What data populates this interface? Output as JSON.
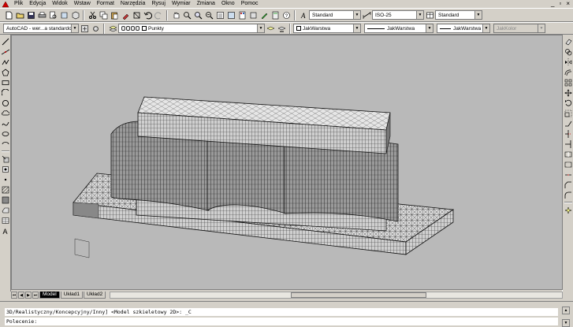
{
  "menu": {
    "items": [
      "Plik",
      "Edycja",
      "Widok",
      "Wstaw",
      "Format",
      "Narzędzia",
      "Rysuj",
      "Wymiar",
      "Zmiana",
      "Okno",
      "Pomoc"
    ],
    "window_controls": [
      "_",
      "▫",
      "×"
    ]
  },
  "toolbar1": {
    "text_style": "Standard",
    "dim_style": "ISO-25",
    "table_style": "Standard"
  },
  "toolbar2": {
    "workspace": "AutoCAD - wer...a standardowy",
    "layer": "Punkty",
    "color": "JakWarstwa",
    "linetype": "JakWarstwa",
    "lineweight": "JakWarstwa",
    "plotstyle": "JakKolor"
  },
  "tabs": {
    "items": [
      "Model",
      "Układ1",
      "Układ2"
    ],
    "active": "Model"
  },
  "command": {
    "history": "3D/Realistyczny/Koncepcyjny/Inny] <Model szkieletowy 2D>: _C",
    "prompt": "Polecenie:"
  },
  "colors": {
    "viewport_bg": "#b9b9b9",
    "ui_bg": "#d4d0c8",
    "active_tab": "#000000"
  },
  "icons": {
    "left_tools": [
      "line-icon",
      "construction-line-icon",
      "polyline-icon",
      "polygon-icon",
      "rectangle-icon",
      "arc-icon",
      "circle-icon",
      "revision-cloud-icon",
      "spline-icon",
      "ellipse-icon",
      "ellipse-arc-icon",
      "insert-block-icon",
      "make-block-icon",
      "point-icon",
      "hatch-icon",
      "gradient-icon",
      "region-icon",
      "table-icon",
      "multiline-text-icon"
    ],
    "right_tools": [
      "erase-icon",
      "copy-icon",
      "mirror-icon",
      "offset-icon",
      "array-icon",
      "move-icon",
      "rotate-icon",
      "scale-icon",
      "stretch-icon",
      "trim-icon",
      "extend-icon",
      "break-at-point-icon",
      "break-icon",
      "join-icon",
      "chamfer-icon",
      "fillet-icon",
      "explode-icon"
    ]
  }
}
